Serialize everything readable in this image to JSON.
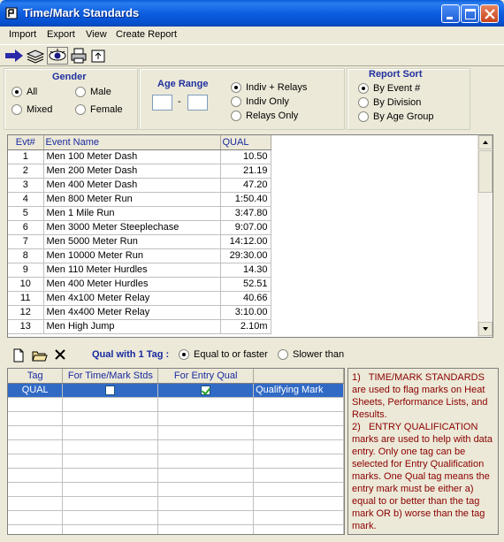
{
  "window": {
    "title": "Time/Mark Standards"
  },
  "menu": [
    "Import",
    "Export",
    "View",
    "Create Report"
  ],
  "toolbar_icons": [
    "arrow-right-icon",
    "layers-icon",
    "eye-icon",
    "printer-icon",
    "export-icon"
  ],
  "gender": {
    "title": "Gender",
    "options": [
      {
        "label": "All",
        "selected": true
      },
      {
        "label": "Male",
        "selected": false
      },
      {
        "label": "Mixed",
        "selected": false
      },
      {
        "label": "Female",
        "selected": false
      }
    ]
  },
  "age_range": {
    "title": "Age Range",
    "separator": "-",
    "from": "",
    "to": ""
  },
  "entry_type": {
    "options": [
      {
        "label": "Indiv + Relays",
        "selected": true
      },
      {
        "label": "Indiv Only",
        "selected": false
      },
      {
        "label": "Relays Only",
        "selected": false
      }
    ]
  },
  "report_sort": {
    "title": "Report Sort",
    "options": [
      {
        "label": "By Event #",
        "selected": true
      },
      {
        "label": "By Division",
        "selected": false
      },
      {
        "label": "By Age Group",
        "selected": false
      }
    ]
  },
  "events": {
    "headers": [
      "Evt#",
      "Event Name",
      "QUAL"
    ],
    "rows": [
      {
        "num": "1",
        "name": "Men 100 Meter Dash",
        "qual": "10.50"
      },
      {
        "num": "2",
        "name": "Men 200 Meter Dash",
        "qual": "21.19"
      },
      {
        "num": "3",
        "name": "Men 400 Meter Dash",
        "qual": "47.20"
      },
      {
        "num": "4",
        "name": "Men 800 Meter Run",
        "qual": "1:50.40"
      },
      {
        "num": "5",
        "name": "Men 1 Mile Run",
        "qual": "3:47.80"
      },
      {
        "num": "6",
        "name": "Men 3000 Meter Steeplechase",
        "qual": "9:07.00"
      },
      {
        "num": "7",
        "name": "Men 5000 Meter Run",
        "qual": "14:12.00"
      },
      {
        "num": "8",
        "name": "Men 10000 Meter Run",
        "qual": "29:30.00"
      },
      {
        "num": "9",
        "name": "Men 110 Meter Hurdles",
        "qual": "14.30"
      },
      {
        "num": "10",
        "name": "Men 400 Meter Hurdles",
        "qual": "52.51"
      },
      {
        "num": "11",
        "name": "Men 4x100 Meter Relay",
        "qual": "40.66"
      },
      {
        "num": "12",
        "name": "Men 4x400 Meter Relay",
        "qual": "3:10.00"
      },
      {
        "num": "13",
        "name": "Men High Jump",
        "qual": "2.10m"
      }
    ]
  },
  "qual_options": {
    "label": "Qual with 1 Tag :",
    "options": [
      {
        "label": "Equal to or faster",
        "selected": true
      },
      {
        "label": "Slower than",
        "selected": false
      }
    ]
  },
  "tags": {
    "headers": [
      "Tag",
      "For Time/Mark Stds",
      "For Entry Qual",
      ""
    ],
    "rows": [
      {
        "tag": "QUAL",
        "time_mark": false,
        "entry_qual": true,
        "desc": "Qualifying Mark"
      }
    ]
  },
  "info": {
    "paragraph1": "1)   TIME/MARK STANDARDS are used to flag marks on Heat Sheets, Performance Lists, and Results.",
    "paragraph2": "2)   ENTRY QUALIFICATION marks are used to help with data entry. Only one tag can be selected for Entry Qualification marks. One Qual tag means the entry mark must be either a) equal to or better than the tag mark OR b) worse than the tag mark."
  }
}
